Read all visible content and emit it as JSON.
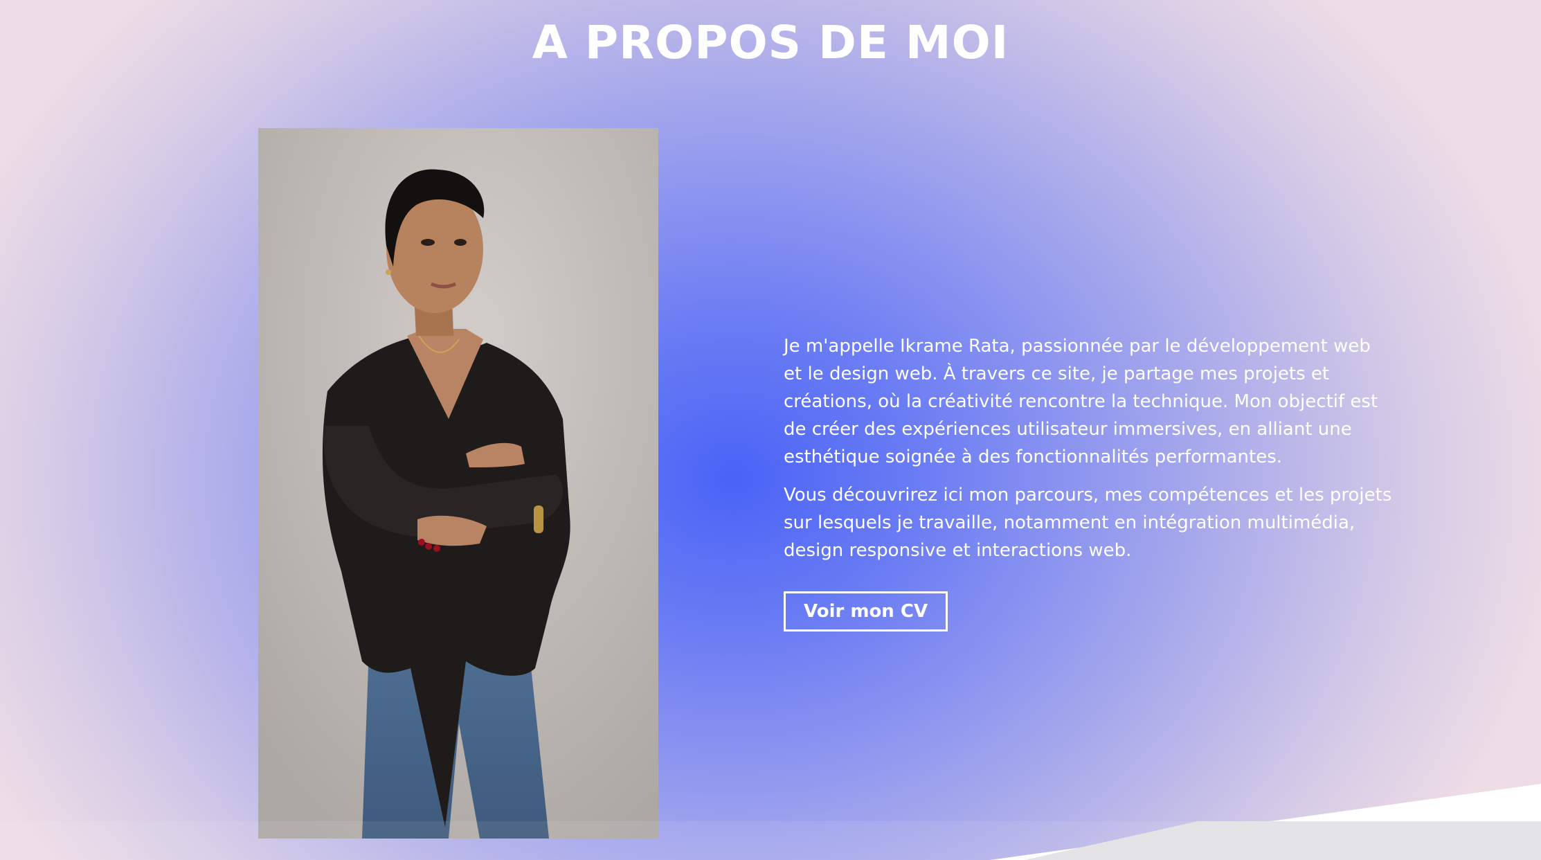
{
  "section": {
    "title": "A PROPOS DE MOI"
  },
  "about": {
    "photo_alt": "Portrait of Ikrame Rata",
    "paragraph1": "Je m'appelle Ikrame Rata, passionnée par le développement web et le design web. À travers ce site, je partage mes projets et créations, où la créativité rencontre la technique. Mon objectif est de créer des expériences utilisateur immersives, en alliant une esthétique soignée à des fonctionnalités performantes.",
    "paragraph2": "Vous découvrirez ici mon parcours, mes compétences et les projets sur lesquels je travaille, notamment en intégration multimédia, design responsive et interactions web.",
    "cv_button_label": "Voir mon CV"
  },
  "colors": {
    "accent": "#4a63f6",
    "background_edge": "#efdde6",
    "text": "#ffffff",
    "footer_wave": "#ffffff",
    "footer_band": "#e4e4e6"
  }
}
